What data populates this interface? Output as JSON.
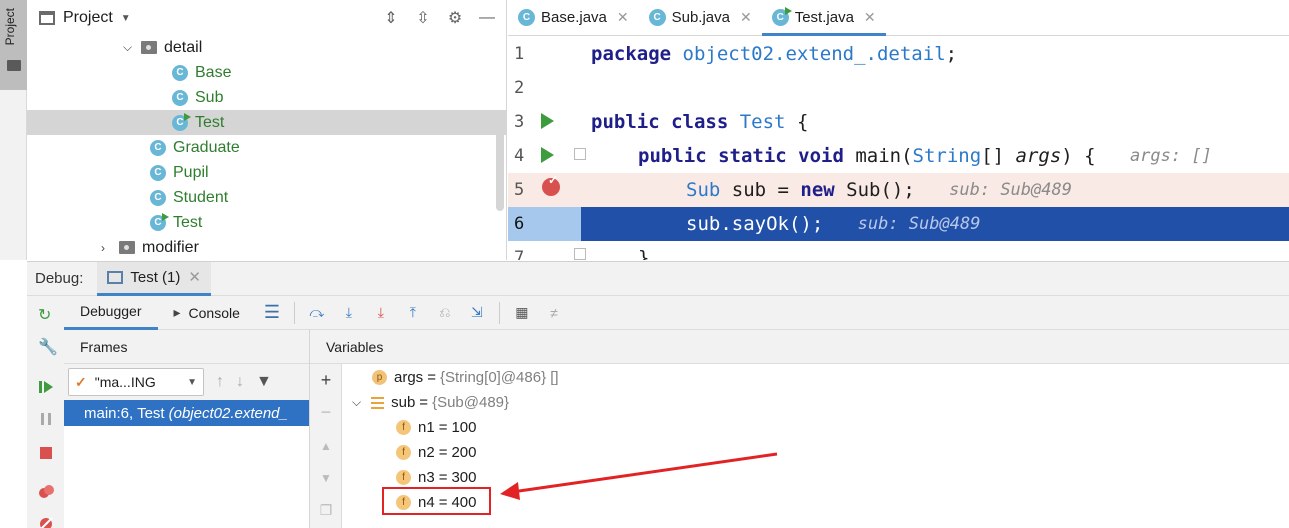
{
  "sidebar": {
    "project_tab": "Project"
  },
  "project": {
    "title": "Project",
    "tree": [
      {
        "label": "detail",
        "type": "package",
        "expanded": true
      },
      {
        "label": "Base",
        "type": "class"
      },
      {
        "label": "Sub",
        "type": "class"
      },
      {
        "label": "Test",
        "type": "runnable",
        "selected": true
      },
      {
        "label": "Graduate",
        "type": "class"
      },
      {
        "label": "Pupil",
        "type": "class"
      },
      {
        "label": "Student",
        "type": "class"
      },
      {
        "label": "Test",
        "type": "runnable"
      },
      {
        "label": "modifier",
        "type": "package",
        "expanded": false
      }
    ]
  },
  "editor": {
    "tabs": [
      {
        "label": "Base.java",
        "active": false
      },
      {
        "label": "Sub.java",
        "active": false
      },
      {
        "label": "Test.java",
        "active": true
      }
    ],
    "line_numbers": [
      "1",
      "2",
      "3",
      "4",
      "5",
      "6",
      "7"
    ],
    "code": {
      "l1_kw": "package",
      "l1_pkg": "object02.extend_.detail",
      "l1_end": ";",
      "l3_kw": "public class",
      "l3_cls": "Test",
      "l3_end": " {",
      "l4_kw": "public static void",
      "l4_name": " main(",
      "l4_type": "String",
      "l4_mid": "[] ",
      "l4_arg": "args",
      "l4_end": ") {",
      "l4_hint": "args: []",
      "l5_type": "Sub",
      "l5_mid": " sub = ",
      "l5_kw": "new",
      "l5_end": " Sub();",
      "l5_hint": "sub: Sub@489",
      "l6_code": "sub.sayOk();",
      "l6_hint": "sub: Sub@489",
      "l7_code": "}"
    },
    "breakpoint_line": 5,
    "current_line": 6
  },
  "debug": {
    "label": "Debug:",
    "session_tab": "Test (1)",
    "subtabs": {
      "debugger": "Debugger",
      "console": "Console"
    },
    "frames": {
      "header": "Frames",
      "thread": "\"ma...ING",
      "selected_frame": "main:6, Test",
      "selected_frame_pkg": "(object02.extend_"
    },
    "variables": {
      "header": "Variables",
      "items": [
        {
          "badge": "p",
          "name": "args",
          "value": "{String[0]@486} []"
        },
        {
          "badge": "lines",
          "name": "sub",
          "value": "{Sub@489}"
        },
        {
          "badge": "f",
          "name": "n1",
          "value": "100"
        },
        {
          "badge": "f",
          "name": "n2",
          "value": "200"
        },
        {
          "badge": "f",
          "name": "n3",
          "value": "300"
        },
        {
          "badge": "f",
          "name": "n4",
          "value": "400"
        }
      ]
    }
  },
  "colors": {
    "accent": "#4083c9",
    "current_line": "#2150a9",
    "annotation": "#e22326",
    "package_green": "#2f7d2f"
  }
}
